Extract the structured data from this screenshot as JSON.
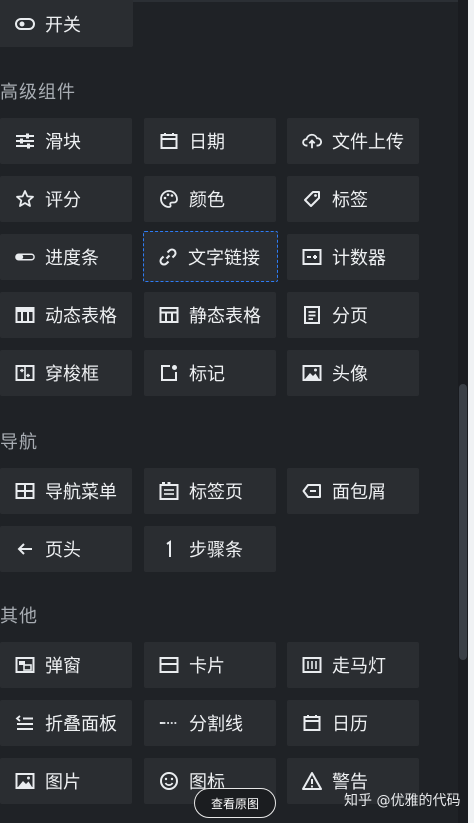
{
  "sections": {
    "advanced": "高级组件",
    "navigation": "导航",
    "other": "其他"
  },
  "tiles": {
    "switch": "开关",
    "slider": "滑块",
    "date": "日期",
    "upload": "文件上传",
    "rate": "评分",
    "color": "颜色",
    "tag": "标签",
    "progress": "进度条",
    "text_link": "文字链接",
    "counter": "计数器",
    "dynamic_table": "动态表格",
    "static_table": "静态表格",
    "pagination": "分页",
    "transfer": "穿梭框",
    "mark": "标记",
    "avatar": "头像",
    "nav_menu": "导航菜单",
    "tabs": "标签页",
    "breadcrumb": "面包屑",
    "page_header": "页头",
    "steps": "步骤条",
    "dialog": "弹窗",
    "card": "卡片",
    "carousel": "走马灯",
    "collapse": "折叠面板",
    "divider": "分割线",
    "calendar": "日历",
    "image": "图片",
    "icon": "图标",
    "alert": "警告"
  },
  "overlay": {
    "view_original": "查看原图",
    "watermark": "知乎 @优雅的代码"
  }
}
